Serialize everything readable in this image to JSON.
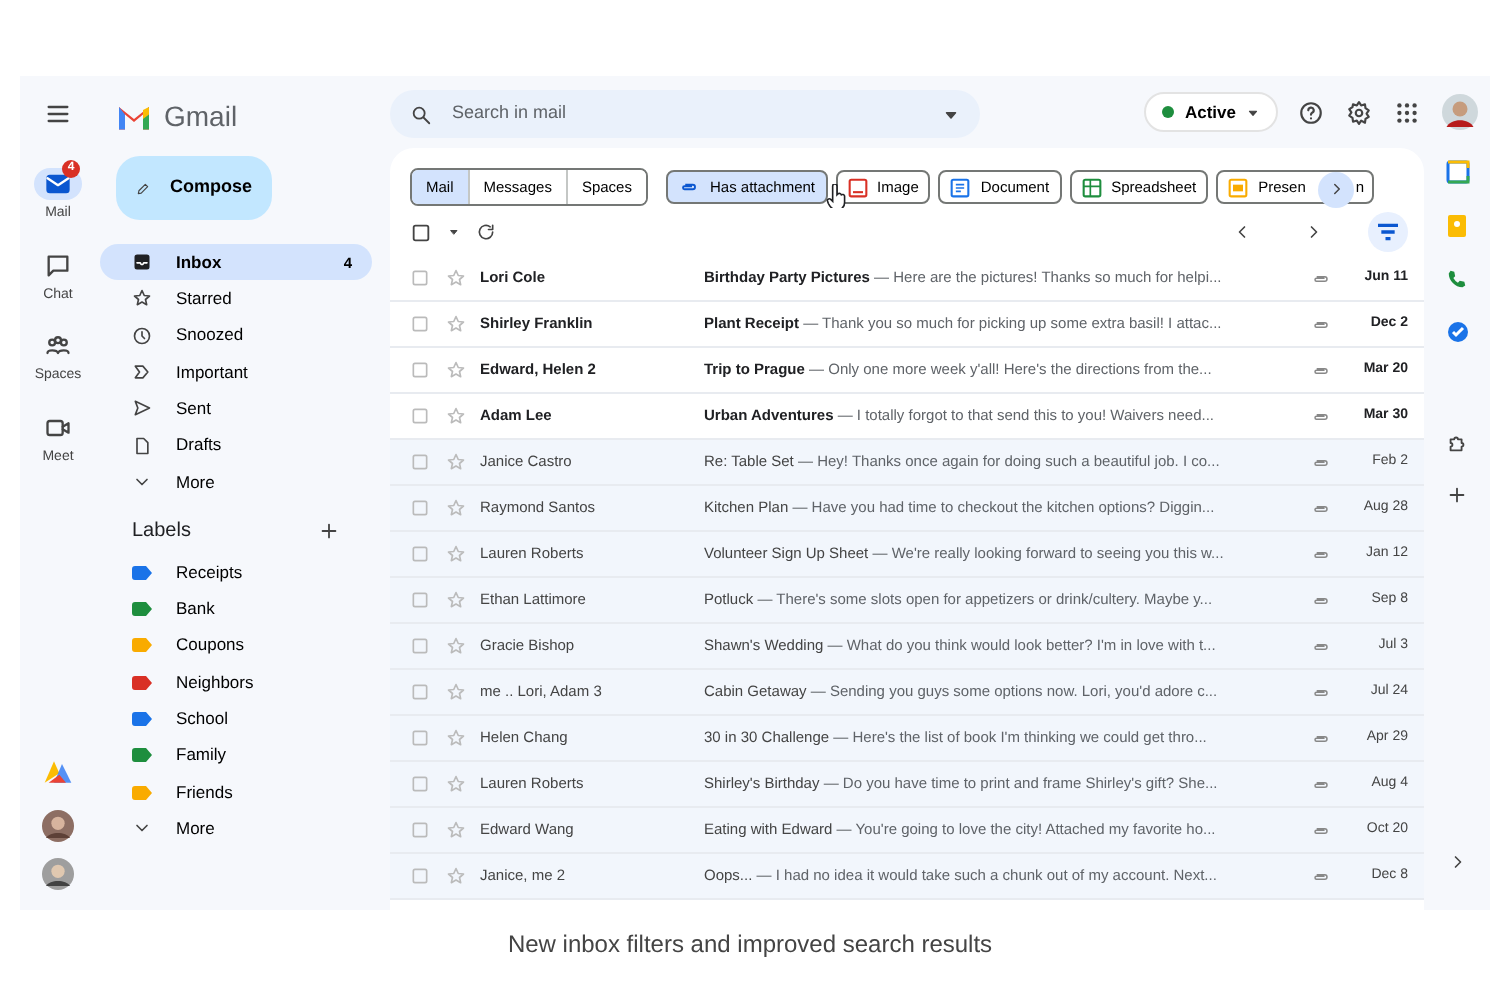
{
  "rail": [
    {
      "label": "Mail",
      "selected": true,
      "badge": "4"
    },
    {
      "label": "Chat",
      "selected": false
    },
    {
      "label": "Spaces",
      "selected": false
    },
    {
      "label": "Meet",
      "selected": false
    }
  ],
  "brand": "Gmail",
  "compose": "Compose",
  "nav": [
    {
      "label": "Inbox",
      "selected": true,
      "count": "4"
    },
    {
      "label": "Starred",
      "selected": false
    },
    {
      "label": "Snoozed",
      "selected": false
    },
    {
      "label": "Important",
      "selected": false
    },
    {
      "label": "Sent",
      "selected": false
    },
    {
      "label": "Drafts",
      "selected": false
    },
    {
      "label": "More",
      "selected": false
    }
  ],
  "labels_heading": "Labels",
  "labels": [
    {
      "label": "Receipts",
      "color": "#1a73e8"
    },
    {
      "label": "Bank",
      "color": "#1e8e3e"
    },
    {
      "label": "Coupons",
      "color": "#f9ab00"
    },
    {
      "label": "Neighbors",
      "color": "#d93025"
    },
    {
      "label": "School",
      "color": "#1a73e8"
    },
    {
      "label": "Family",
      "color": "#1e8e3e"
    },
    {
      "label": "Friends",
      "color": "#f9ab00"
    }
  ],
  "labels_more": "More",
  "search": {
    "placeholder": "Search in mail"
  },
  "status": "Active",
  "segments": [
    {
      "label": "Mail",
      "selected": true
    },
    {
      "label": "Messages",
      "selected": false
    },
    {
      "label": "Spaces",
      "selected": false
    }
  ],
  "chips": [
    {
      "label": "Has attachment",
      "selected": true
    },
    {
      "label": "Image",
      "selected": false
    },
    {
      "label": "Document",
      "selected": false
    },
    {
      "label": "Spreadsheet",
      "selected": false
    },
    {
      "label": "Presen",
      "selected": false,
      "tail": "n"
    }
  ],
  "emails": [
    {
      "sender": "Lori Cole",
      "unread": true,
      "subject": "Birthday Party Pictures",
      "snippet": "— Here are the pictures! Thanks so much for helpi...",
      "date": "Jun 11"
    },
    {
      "sender": "Shirley Franklin",
      "unread": true,
      "subject": "Plant Receipt",
      "snippet": "— Thank you so much for picking up some extra basil! I attac...",
      "date": "Dec 2"
    },
    {
      "sender": "Edward, Helen 2",
      "unread": true,
      "subject": "Trip to Prague",
      "snippet": "— Only one more week y'all! Here's the directions from the...",
      "date": "Mar 20"
    },
    {
      "sender": "Adam Lee",
      "unread": true,
      "subject": "Urban Adventures",
      "snippet": "— I totally forgot to that send this to you! Waivers need...",
      "date": "Mar 30"
    },
    {
      "sender": "Janice Castro",
      "unread": false,
      "subject": "Re: Table Set",
      "snippet": "— Hey! Thanks once again for doing such a beautiful job. I co...",
      "date": "Feb 2"
    },
    {
      "sender": "Raymond Santos",
      "unread": false,
      "subject": "Kitchen Plan",
      "snippet": "— Have you had time to checkout the kitchen options? Diggin...",
      "date": "Aug 28"
    },
    {
      "sender": "Lauren Roberts",
      "unread": false,
      "subject": "Volunteer Sign Up Sheet",
      "snippet": "— We're really looking forward to seeing you this w...",
      "date": "Jan 12"
    },
    {
      "sender": "Ethan Lattimore",
      "unread": false,
      "subject": "Potluck",
      "snippet": "— There's some slots open for appetizers or drink/cultery. Maybe y...",
      "date": "Sep 8"
    },
    {
      "sender": "Gracie Bishop",
      "unread": false,
      "subject": "Shawn's Wedding",
      "snippet": "— What do you think would look better? I'm in love with t...",
      "date": "Jul 3"
    },
    {
      "sender": "me .. Lori, Adam 3",
      "unread": false,
      "subject": "Cabin Getaway",
      "snippet": "— Sending you guys some options now. Lori, you'd adore c...",
      "date": "Jul 24"
    },
    {
      "sender": "Helen Chang",
      "unread": false,
      "subject": "30 in 30 Challenge",
      "snippet": "— Here's the list of book I'm thinking we could get thro...",
      "date": "Apr 29"
    },
    {
      "sender": "Lauren Roberts",
      "unread": false,
      "subject": "Shirley's Birthday",
      "snippet": "— Do you have time to print and frame Shirley's gift? She...",
      "date": "Aug 4"
    },
    {
      "sender": "Edward Wang",
      "unread": false,
      "subject": "Eating with Edward",
      "snippet": "— You're going to love the city! Attached my favorite ho...",
      "date": "Oct 20"
    },
    {
      "sender": "Janice, me 2",
      "unread": false,
      "subject": "Oops...",
      "snippet": "— I had no idea it would take such a chunk out of my account. Next...",
      "date": "Dec 8"
    }
  ],
  "caption": "New inbox filters and improved search results"
}
